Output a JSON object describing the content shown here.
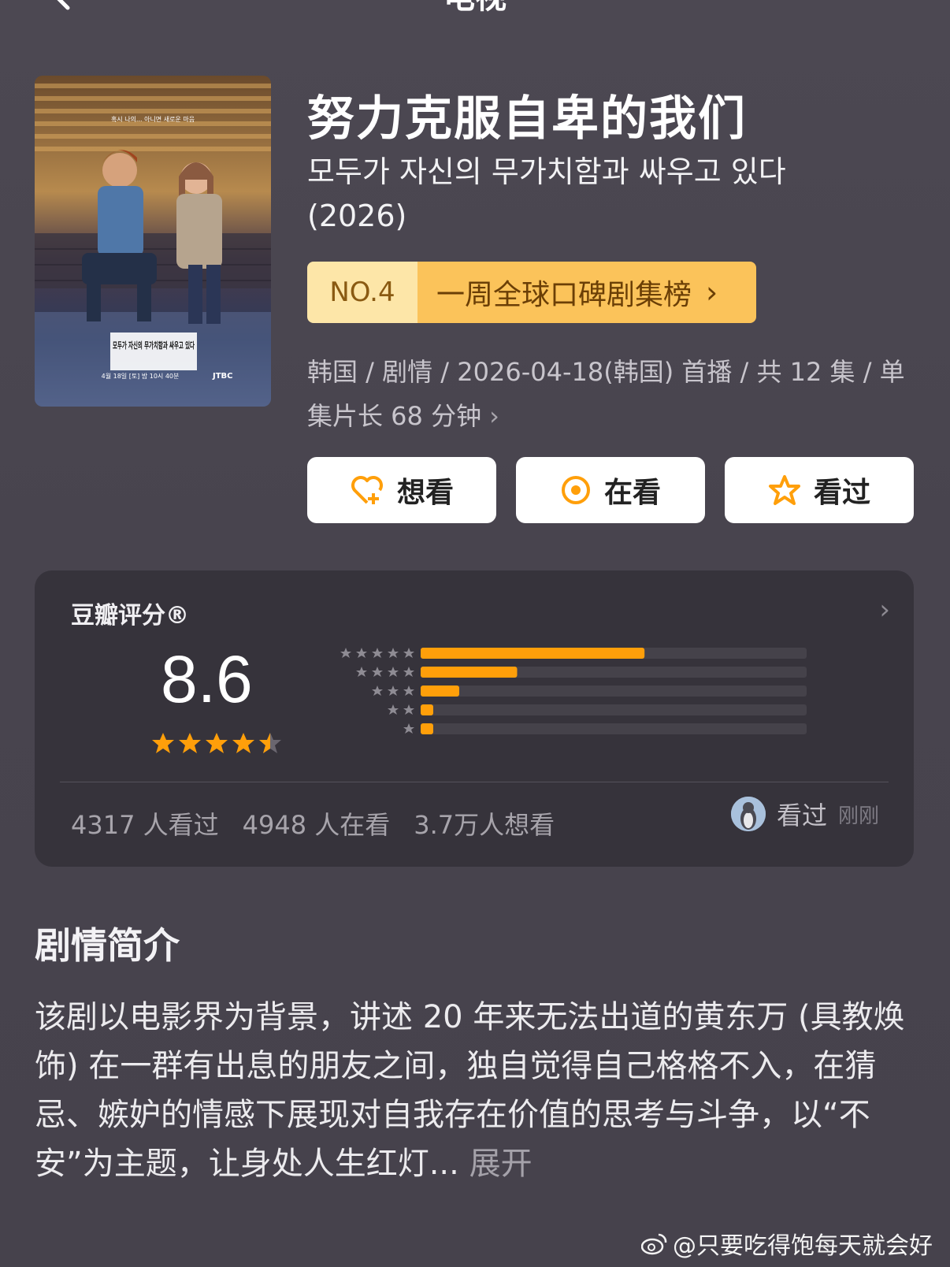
{
  "header": {
    "back": "back",
    "title": "电视"
  },
  "poster": {
    "tagline": "혹시 나의... 아니면 새로운 마음",
    "title_ko": "모두가 자신의 무가치함과 싸우고 있다",
    "air_info": "4월 18일 [토] 밤 10시 40분",
    "network": "JTBC"
  },
  "show": {
    "title": "努力克服自卑的我们",
    "original_title": "모두가 자신의 무가치함과 싸우고 있다",
    "year": "(2026)"
  },
  "rank": {
    "no": "NO.4",
    "list": "一周全球口碑剧集榜",
    "chevron": "›"
  },
  "meta": {
    "text": "韩国 / 剧情 / 2026-04-18(韩国) 首播 / 共 12 集 / 单集片长 68 分钟",
    "chevron": "›"
  },
  "actions": {
    "want": "想看",
    "watching": "在看",
    "watched": "看过"
  },
  "rating": {
    "label": "豆瓣评分®",
    "arrow": "›",
    "score": "8.6",
    "stars": 4.5,
    "distribution": [
      {
        "stars": 5,
        "fraction": 0.58
      },
      {
        "stars": 4,
        "fraction": 0.25
      },
      {
        "stars": 3,
        "fraction": 0.1
      },
      {
        "stars": 2,
        "fraction": 0.03
      },
      {
        "stars": 1,
        "fraction": 0.03
      }
    ],
    "watched_count": "4317 人看过",
    "watching_count": "4948 人在看",
    "want_count": "3.7万人想看",
    "friend_status": "看过",
    "friend_time": "刚刚"
  },
  "synopsis": {
    "heading": "剧情简介",
    "text": "该剧以电影界为背景，讲述 20 年来无法出道的黄东万 (具教焕 饰) 在一群有出息的朋友之间，独自觉得自己格格不入，在猜忌、嫉妒的情感下展现对自我存在价值的思考与斗争，以“不安”为主题，让身处人生红灯...",
    "expand": "展开"
  },
  "watermark": "@只要吃得饱每天就会好",
  "colors": {
    "accent": "#ff9f0a",
    "rank_bg": "#fbc35a",
    "card": "#36333b"
  }
}
